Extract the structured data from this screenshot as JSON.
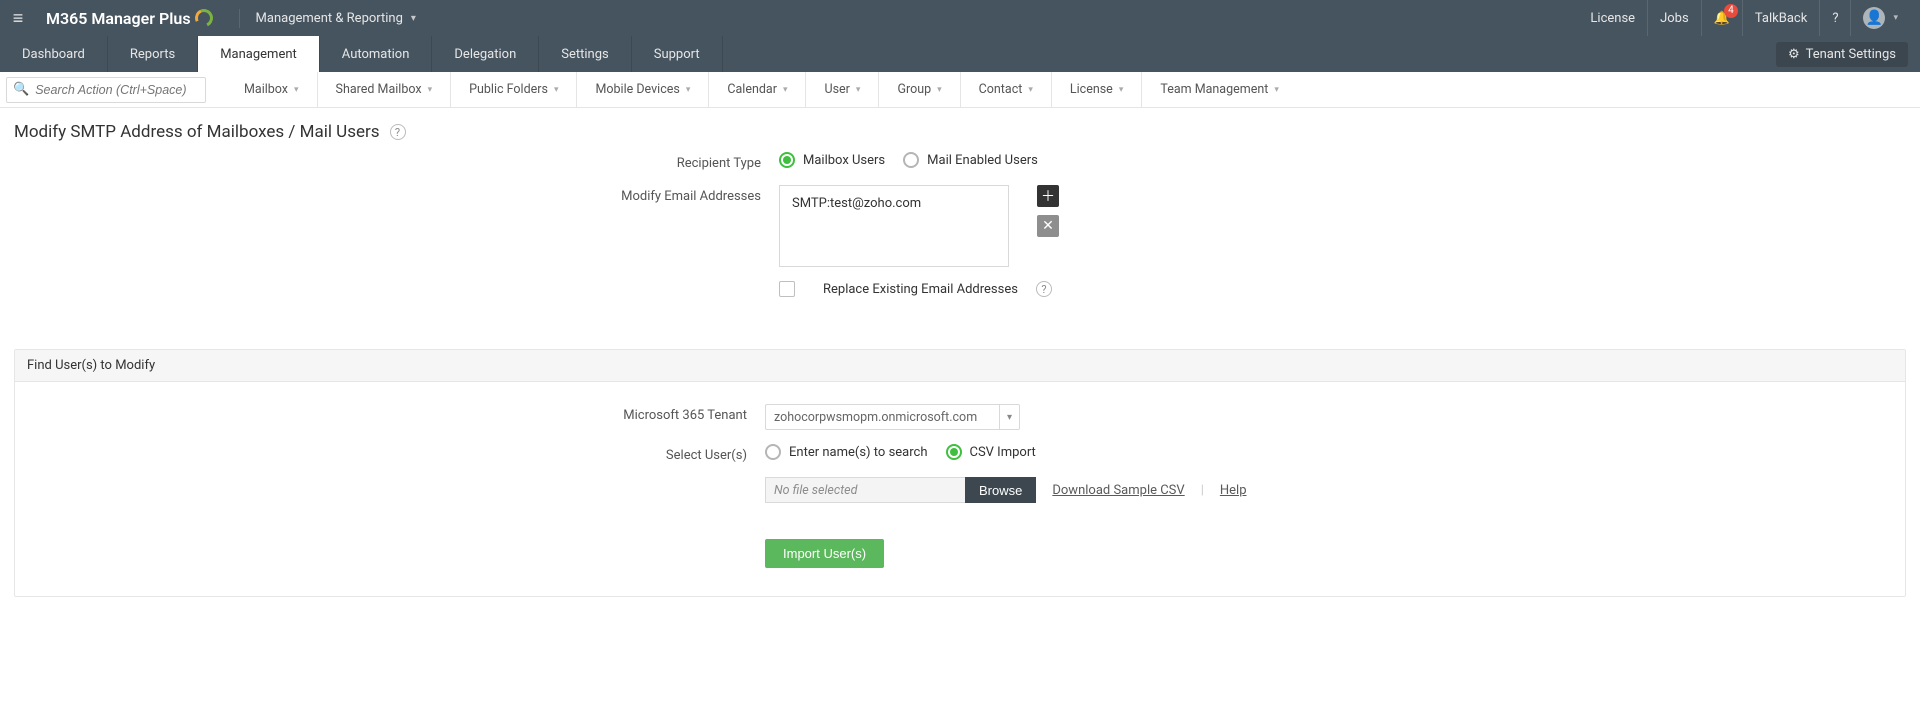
{
  "brand": "M365 Manager Plus",
  "topnav": {
    "section": "Management & Reporting"
  },
  "topright": {
    "license": "License",
    "jobs": "Jobs",
    "talkback": "TalkBack",
    "notif_count": "4"
  },
  "tabs": {
    "dashboard": "Dashboard",
    "reports": "Reports",
    "management": "Management",
    "automation": "Automation",
    "delegation": "Delegation",
    "settings": "Settings",
    "support": "Support",
    "tenant_settings": "Tenant Settings"
  },
  "search_placeholder": "Search Action (Ctrl+Space)",
  "toolbar_items": [
    "Mailbox",
    "Shared Mailbox",
    "Public Folders",
    "Mobile Devices",
    "Calendar",
    "User",
    "Group",
    "Contact",
    "License",
    "Team Management"
  ],
  "page_title": "Modify SMTP Address of Mailboxes / Mail Users",
  "form": {
    "recipient_type_label": "Recipient Type",
    "recipient_opt1": "Mailbox Users",
    "recipient_opt2": "Mail Enabled Users",
    "modify_label": "Modify Email Addresses",
    "address_value": "SMTP:test@zoho.com",
    "replace_label": "Replace Existing Email Addresses"
  },
  "find_panel": {
    "title": "Find User(s) to Modify",
    "tenant_label": "Microsoft 365 Tenant",
    "tenant_value": "zohocorpwsmopm.onmicrosoft.com",
    "select_user_label": "Select User(s)",
    "opt_search": "Enter name(s) to search",
    "opt_csv": "CSV Import",
    "no_file": "No file selected",
    "browse": "Browse",
    "download_csv": "Download Sample CSV",
    "help": "Help",
    "import_btn": "Import User(s)"
  }
}
